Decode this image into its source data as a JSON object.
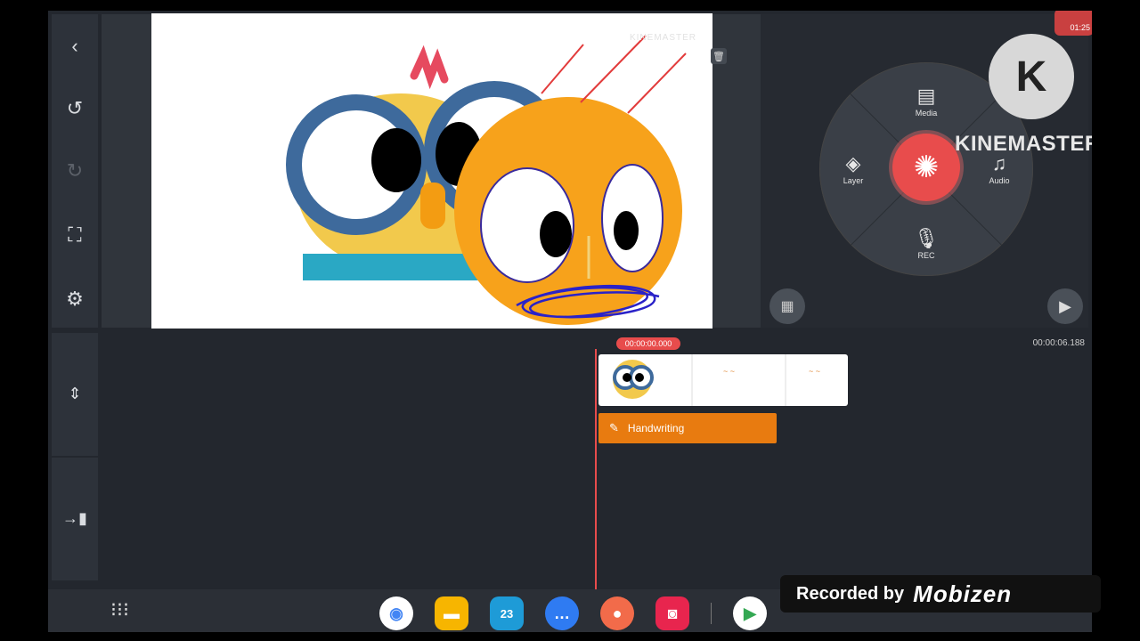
{
  "left_toolbar": {
    "back_icon": "back-arrow-icon",
    "undo_icon": "undo-icon",
    "redo_icon": "redo-icon",
    "fit_icon": "screen-fit-icon",
    "settings_icon": "settings-icon"
  },
  "preview": {
    "watermark": "KINEMASTER"
  },
  "media_wheel": {
    "items": [
      {
        "label": "Media",
        "icon": "media-icon"
      },
      {
        "label": "Layer",
        "icon": "layer-icon"
      },
      {
        "label": "Audio",
        "icon": "audio-icon"
      },
      {
        "label": "REC",
        "icon": "mic-icon"
      }
    ],
    "center_icon": "camera-shutter-icon"
  },
  "kinemaster_logo": {
    "letter": "K",
    "text": "KINEMASTER"
  },
  "recording_indicator": {
    "time": "01:25"
  },
  "timeline": {
    "current_time": "00:00:00.000",
    "end_time": "00:00:06.188",
    "layers": [
      {
        "label": "Handwriting",
        "color": "#E87B10"
      }
    ]
  },
  "dock": {
    "calendar_day": "23"
  },
  "recorder": {
    "prefix": "Recorded by",
    "brand": "Mobizen"
  },
  "colors": {
    "accent_red": "#E84C4C",
    "handwriting_orange": "#E87B10",
    "background": "#23272E"
  }
}
